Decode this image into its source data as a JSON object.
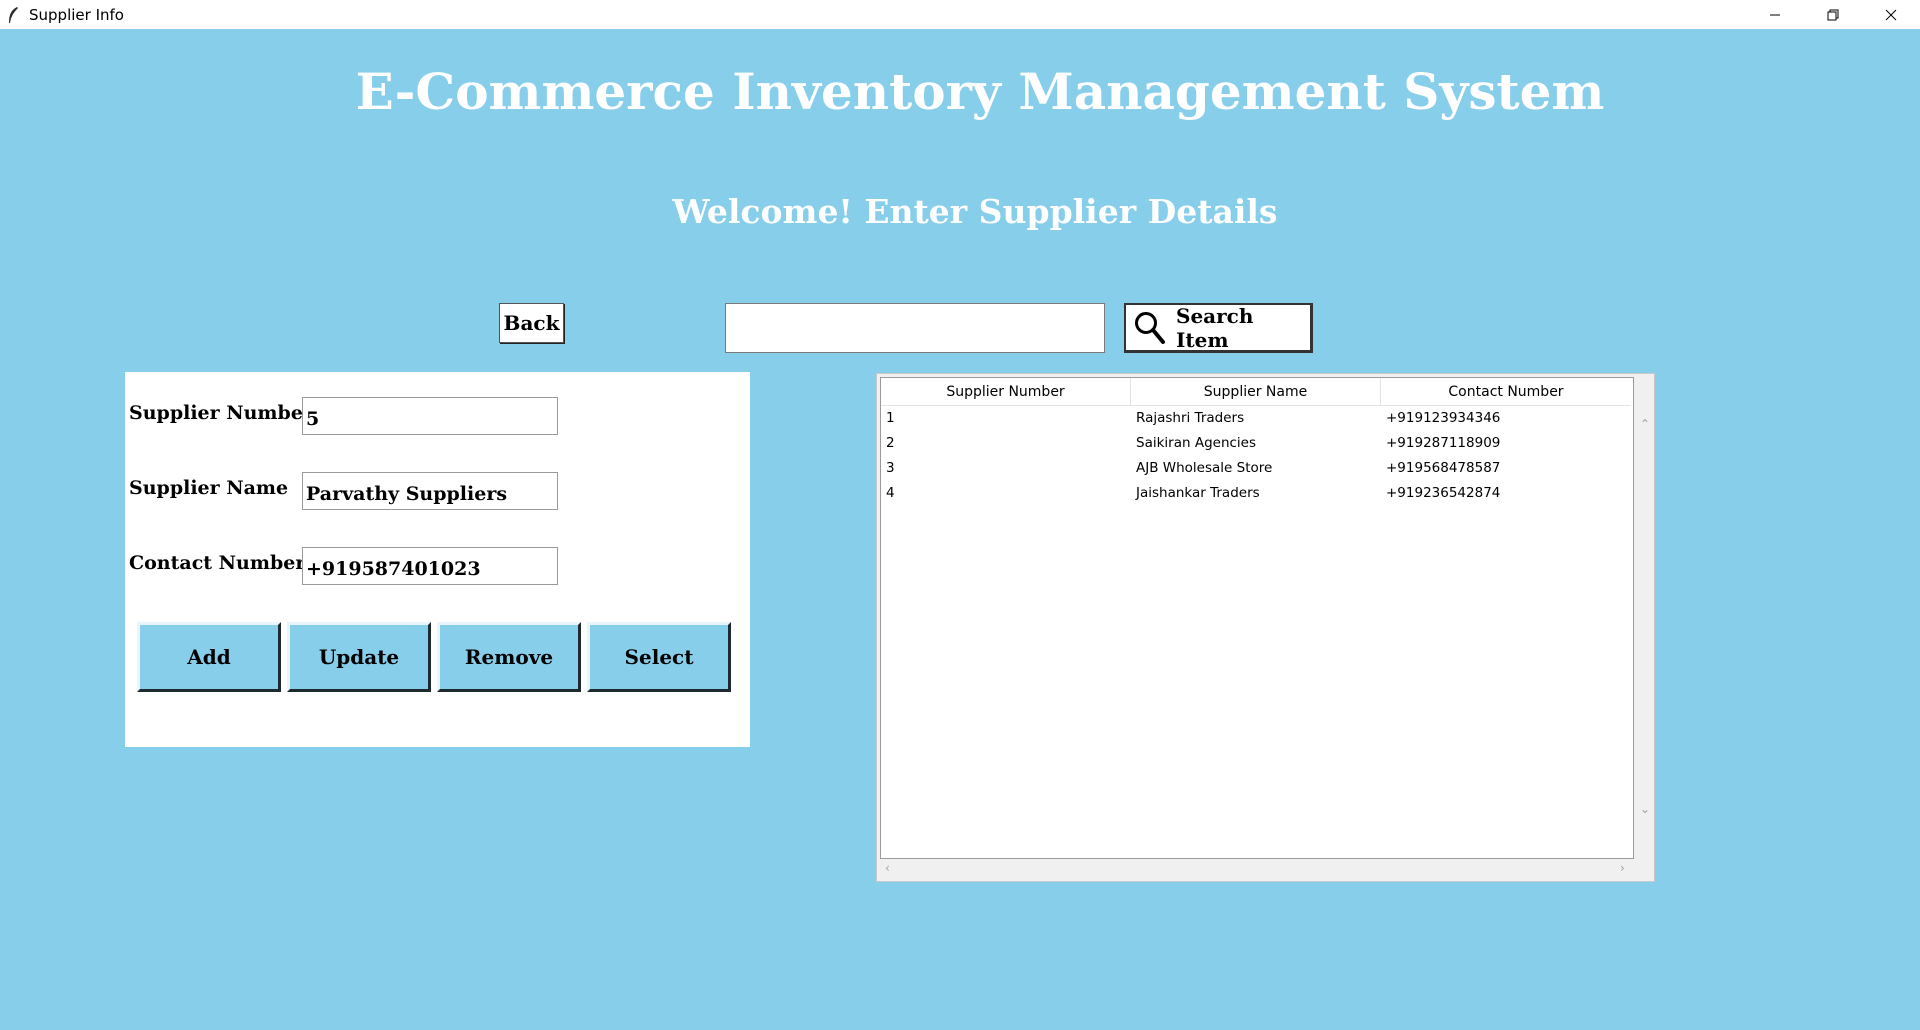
{
  "window": {
    "title": "Supplier Info",
    "minimize_icon": "minimize-icon",
    "restore_icon": "restore-icon",
    "close_icon": "close-icon"
  },
  "header": {
    "title": "E-Commerce Inventory Management System",
    "subtitle": "Welcome! Enter Supplier Details"
  },
  "toolbar": {
    "back_label": "Back",
    "search_value": "",
    "search_label": "Search Item",
    "search_icon": "search-icon"
  },
  "form": {
    "supplier_number_label": "Supplier Number",
    "supplier_number_value": "5",
    "supplier_name_label": "Supplier Name",
    "supplier_name_value": "Parvathy Suppliers",
    "contact_number_label": "Contact Number",
    "contact_number_value": "+919587401023",
    "buttons": {
      "add": "Add",
      "update": "Update",
      "remove": "Remove",
      "select": "Select"
    }
  },
  "table": {
    "columns": [
      "Supplier Number",
      "Supplier Name",
      "Contact Number"
    ],
    "rows": [
      [
        "1",
        "Rajashri Traders",
        "+919123934346"
      ],
      [
        "2",
        "Saikiran Agencies",
        "+919287118909"
      ],
      [
        "3",
        "AJB Wholesale Store",
        "+919568478587"
      ],
      [
        "4",
        "Jaishankar Traders",
        "+919236542874"
      ]
    ]
  },
  "colors": {
    "background": "#87ceeb",
    "panel": "#ffffff",
    "title_text": "#ffffff"
  }
}
